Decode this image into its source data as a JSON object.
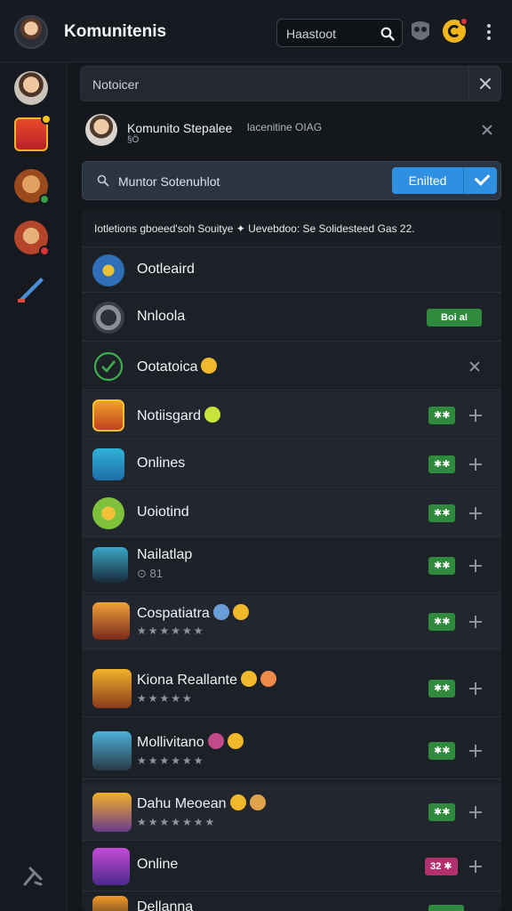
{
  "app": {
    "title": "Komunitenis"
  },
  "search": {
    "value": "Haastoot",
    "placeholder": "Haastoot"
  },
  "notice": {
    "text": "Notoicer"
  },
  "profile": {
    "name": "Komunito Stepalee",
    "sub": "§Ö",
    "meta": "lacenitine OIAG"
  },
  "filter": {
    "text": "Muntor Sotenuhlot",
    "button_label": "Enilted"
  },
  "list": {
    "header": "Iotletions ɡboeed'soh Souitye ✦ Uevebdoo: Se Solidesteed Gas 22.",
    "rows": [
      {
        "title": "Ootleaird",
        "sub": "",
        "badge": "",
        "action": "none"
      },
      {
        "title": "Nnloola",
        "sub": "",
        "badge": "Boi aI",
        "action": "none"
      },
      {
        "title": "Ootatoica",
        "sub": "",
        "badge": "",
        "action": "close"
      },
      {
        "title": "Notiisgard",
        "sub": "",
        "badge": "✱✱",
        "action": "add"
      },
      {
        "title": "Onlines",
        "sub": "",
        "badge": "✱✱",
        "action": "add"
      },
      {
        "title": "Uoiotind",
        "sub": "",
        "badge": "✱✱",
        "action": "add"
      },
      {
        "title": "Nailatlap",
        "sub": "⊙ 81",
        "badge": "✱✱",
        "action": "add"
      },
      {
        "title": "Cospatiatra",
        "sub": "★★★★★★",
        "badge": "✱✱",
        "action": "add"
      },
      {
        "title": "Kiona Reallante",
        "sub": "★★★★★",
        "badge": "✱✱",
        "action": "add"
      },
      {
        "title": "Mollivitano",
        "sub": "★★★★★★",
        "badge": "✱✱",
        "action": "add"
      },
      {
        "title": "Dahu Meoean",
        "sub": "★★★★★★★",
        "badge": "✱✱",
        "action": "add"
      },
      {
        "title": "Online",
        "sub": "",
        "badge": "32 ✱",
        "action": "add"
      },
      {
        "title": "Dellanna",
        "sub": "",
        "badge": "",
        "action": "none"
      }
    ]
  },
  "colors": {
    "accent": "#2f8fe0",
    "badge_green": "#2f8a3e",
    "badge_pink": "#b3306e",
    "background": "#14171c"
  }
}
